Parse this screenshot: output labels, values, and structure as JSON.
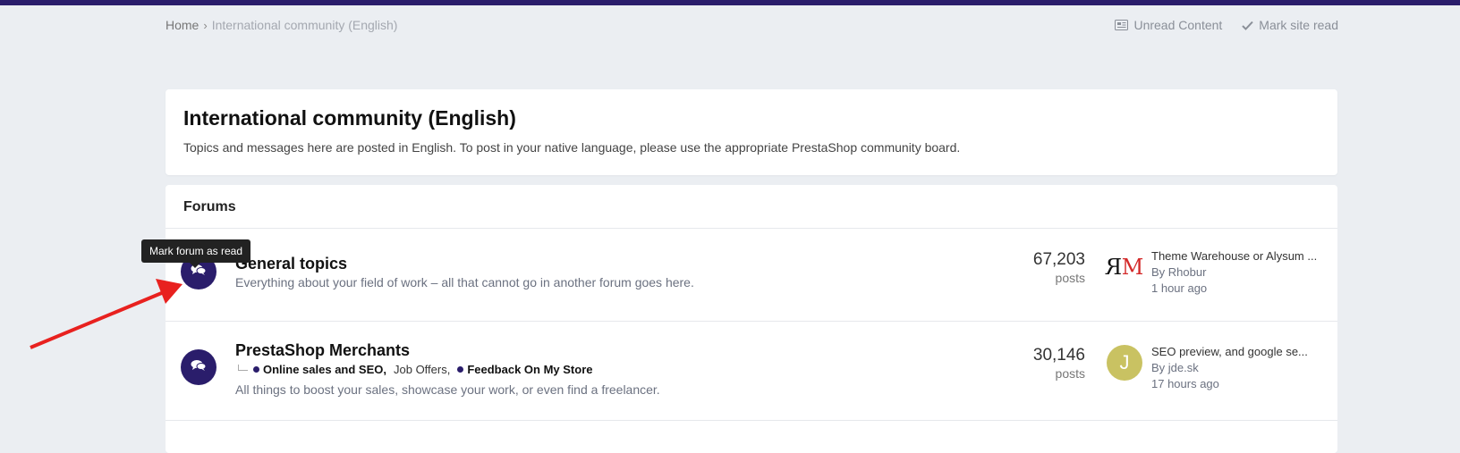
{
  "breadcrumb": {
    "home": "Home",
    "separator": "›",
    "current": "International community (English)"
  },
  "top_actions": {
    "unread": "Unread Content",
    "mark_read": "Mark site read"
  },
  "header": {
    "title": "International community (English)",
    "description": "Topics and messages here are posted in English. To post in your native language, please use the appropriate PrestaShop community board."
  },
  "forums": {
    "heading": "Forums",
    "items": [
      {
        "title": "General topics",
        "description": "Everything about your field of work – all that cannot go in another forum goes here.",
        "posts": "67,203",
        "posts_label": "posts",
        "last_title": "Theme Warehouse or Alysum ...",
        "last_by": "By Rhobur",
        "last_time": "1 hour ago",
        "avatar": "ЯM logo"
      },
      {
        "title": "PrestaShop Merchants",
        "subforums": [
          "Online sales and SEO,",
          "Job Offers,",
          "Feedback On My Store"
        ],
        "description": "All things to boost your sales, showcase your work, or even find a freelancer.",
        "posts": "30,146",
        "posts_label": "posts",
        "last_title": "SEO preview, and google se...",
        "last_by": "By jde.sk",
        "last_time": "17 hours ago",
        "avatar_letter": "J"
      }
    ]
  },
  "tooltip": "Mark forum as read",
  "colors": {
    "brand": "#2a1d6b",
    "arrow": "#e8211f",
    "avatar_j": "#c9c262"
  },
  "icons": {
    "unread": "newspaper-icon",
    "mark_read": "check-icon",
    "forum": "comments-icon"
  }
}
